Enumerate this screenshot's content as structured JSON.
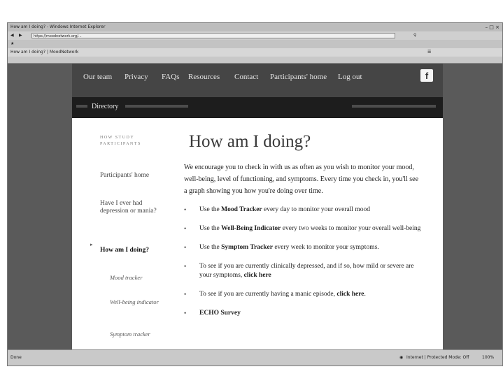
{
  "browser": {
    "window_title": "How am I doing? - Windows Internet Explorer",
    "address": "https://moodnetwork.org/...",
    "tab_label": "How am I doing? | MoodNetwork",
    "status_left": "Done",
    "status_zone": "Internet | Protected Mode: Off",
    "zoom": "100%"
  },
  "nav": {
    "items": [
      "Our team",
      "Privacy",
      "FAQs",
      "Resources",
      "Contact",
      "Participants' home",
      "Log out"
    ],
    "facebook": "f"
  },
  "subbar": {
    "label": "Directory"
  },
  "sidebar": {
    "heading": "HOW STUDY PARTICIPANTS",
    "items": [
      "Participants' home",
      "Have I ever had depression or mania?",
      "How am I doing?"
    ],
    "subitems": [
      "Mood tracker",
      "Well-being indicator",
      "Symptom tracker"
    ]
  },
  "main": {
    "title": "How am I doing?",
    "intro": "We encourage you to check in with us as often as you wish to monitor your mood, well-being, level of functioning, and symptoms. Every time you check in, you'll see a graph showing you how you're doing over time.",
    "bullets": [
      {
        "pre": "Use the ",
        "bold": "Mood Tracker",
        "post": " every day to monitor your overall mood"
      },
      {
        "pre": "Use the ",
        "bold": "Well-Being Indicator",
        "post": " every two weeks to monitor your overall well-being"
      },
      {
        "pre": "Use the ",
        "bold": "Symptom Tracker",
        "post": " every week to monitor your symptoms."
      },
      {
        "pre": "To see if you are currently clinically depressed, and if so, how mild or severe are your symptoms, ",
        "bold": "click here",
        "post": ""
      },
      {
        "pre": "To see if you are currently having a manic episode, ",
        "bold": "click here",
        "post": "."
      },
      {
        "pre": "",
        "bold": "ECHO Survey",
        "post": ""
      }
    ]
  }
}
